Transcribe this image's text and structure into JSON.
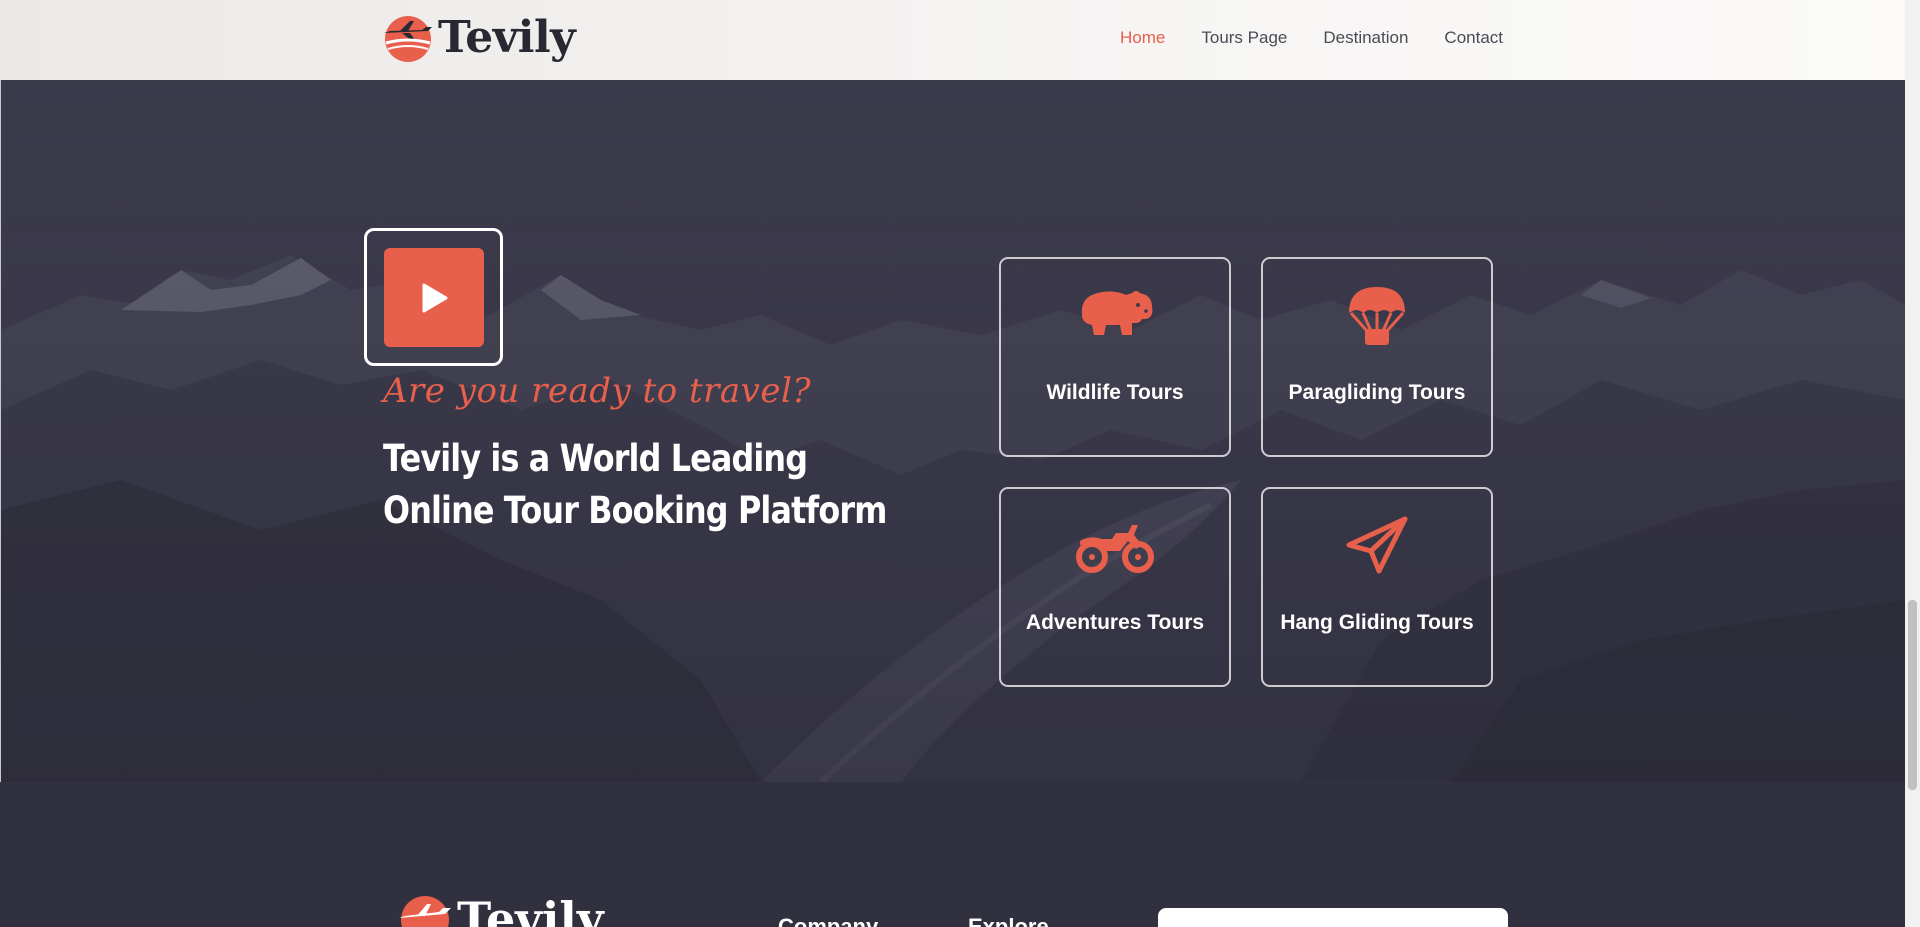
{
  "header": {
    "brand": "Tevily",
    "nav": [
      {
        "label": "Home",
        "active": true
      },
      {
        "label": "Tours Page",
        "active": false
      },
      {
        "label": "Destination",
        "active": false
      },
      {
        "label": "Contact",
        "active": false
      }
    ]
  },
  "hero": {
    "tagline": "Are you ready to travel?",
    "headline": "Tevily is a World Leading Online Tour Booking Platform",
    "play_icon": "play-icon",
    "cards": [
      {
        "label": "Wildlife Tours",
        "icon": "hippo-icon"
      },
      {
        "label": "Paragliding Tours",
        "icon": "parachute-icon"
      },
      {
        "label": "Adventures Tours",
        "icon": "motorcycle-icon"
      },
      {
        "label": "Hang Gliding Tours",
        "icon": "paper-plane-icon"
      }
    ]
  },
  "footer": {
    "brand": "Tevily",
    "columns": [
      "Company",
      "Explore"
    ]
  },
  "colors": {
    "accent": "#e8604b",
    "dark": "#30303e",
    "header_bg": "#f6f5f4"
  }
}
